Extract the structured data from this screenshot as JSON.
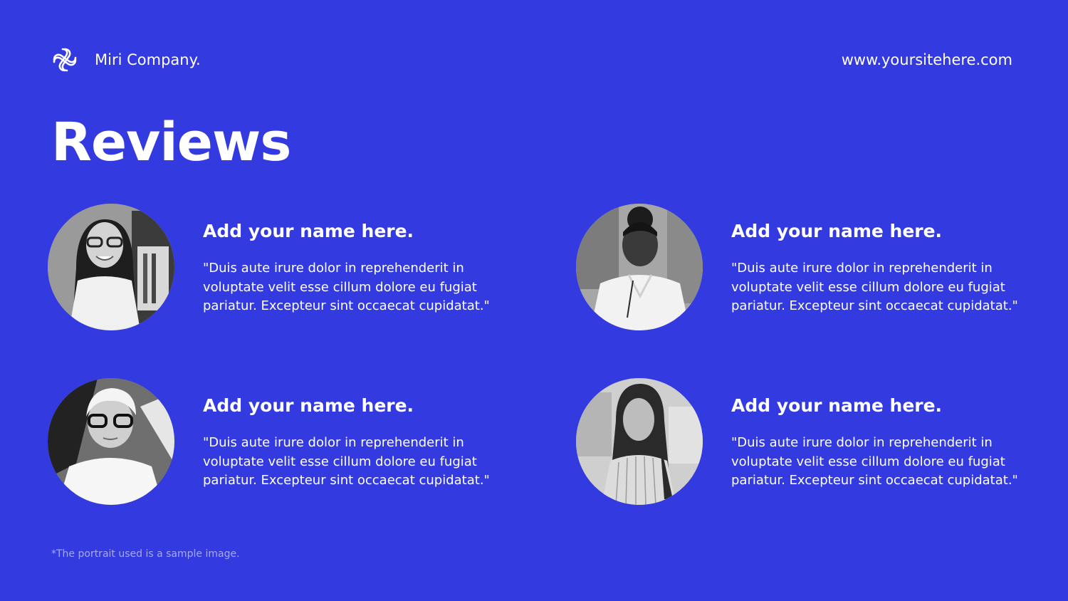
{
  "header": {
    "logo_icon": "interlocking-knot-icon",
    "brand_name": "Miri Company.",
    "website": "www.yoursitehere.com"
  },
  "page": {
    "title": "Reviews"
  },
  "reviews": [
    {
      "name": "Add your name here.",
      "quote": "\"Duis aute irure dolor in reprehenderit in voluptate velit esse cillum dolore eu fugiat pariatur. Excepteur sint occaecat cupidatat.\"",
      "avatar": "portrait-woman-glasses-photo"
    },
    {
      "name": "Add your name here.",
      "quote": "\"Duis aute irure dolor in reprehenderit in voluptate velit esse cillum dolore eu fugiat pariatur. Excepteur sint occaecat cupidatat.\"",
      "avatar": "portrait-woman-white-shirt-photo"
    },
    {
      "name": "Add your name here.",
      "quote": "\"Duis aute irure dolor in reprehenderit in voluptate velit esse cillum dolore eu fugiat pariatur. Excepteur sint occaecat cupidatat.\"",
      "avatar": "portrait-older-woman-glasses-photo"
    },
    {
      "name": "Add your name here.",
      "quote": "\"Duis aute irure dolor in reprehenderit in voluptate velit esse cillum dolore eu fugiat pariatur. Excepteur sint occaecat cupidatat.\"",
      "avatar": "portrait-woman-long-hair-photo"
    }
  ],
  "footer": {
    "note": "*The portrait used is a sample image."
  },
  "colors": {
    "background": "#333ADF",
    "text": "#FFFFFF",
    "footnote": "#A7AAF0"
  }
}
